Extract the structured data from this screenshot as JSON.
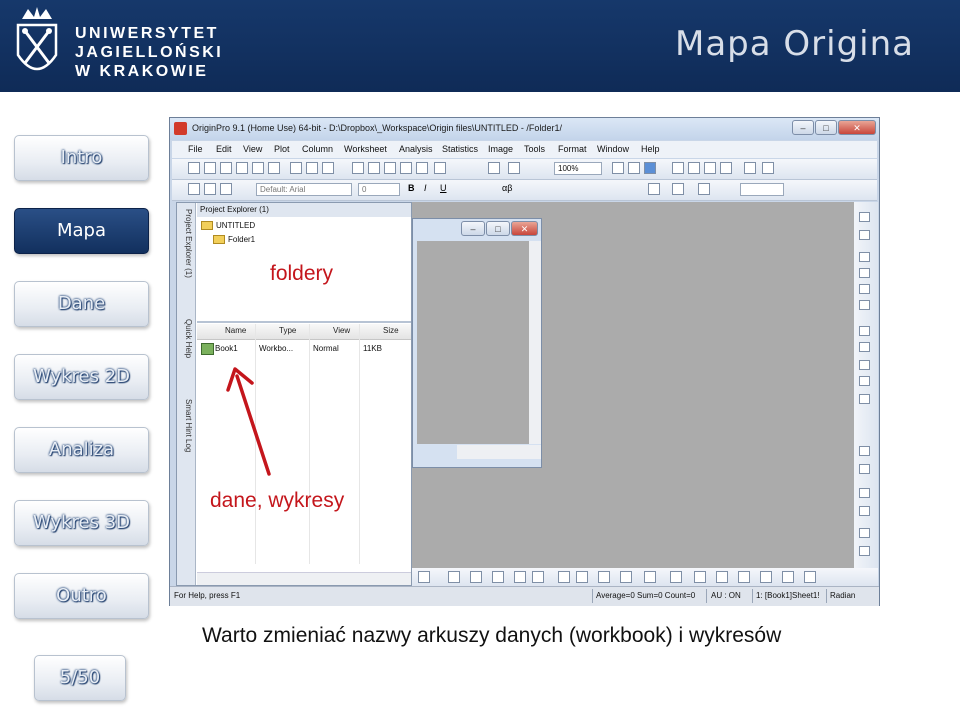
{
  "header": {
    "logo_lines": [
      "UNIWERSYTET",
      "JAGIELLOŃSKI",
      "W KRAKOWIE"
    ],
    "slide_title": "Mapa Origina"
  },
  "nav": {
    "items": [
      {
        "label": "Intro",
        "active": false
      },
      {
        "label": "Mapa",
        "active": true
      },
      {
        "label": "Dane",
        "active": false
      },
      {
        "label": "Wykres 2D",
        "active": false
      },
      {
        "label": "Analiza",
        "active": false
      },
      {
        "label": "Wykres 3D",
        "active": false
      },
      {
        "label": "Outro",
        "active": false
      }
    ],
    "page_counter": "5/50"
  },
  "origin": {
    "title": "OriginPro 9.1 (Home Use) 64-bit - D:\\Dropbox\\_Workspace\\Origin files\\UNTITLED - /Folder1/",
    "menu": [
      "File",
      "Edit",
      "View",
      "Plot",
      "Column",
      "Worksheet",
      "Analysis",
      "Statistics",
      "Image",
      "Tools",
      "Format",
      "Window",
      "Help"
    ],
    "zoom": "100%",
    "font_combo": "Default: Arial",
    "size_combo": "0",
    "explorer_title": "Project Explorer (1)",
    "side_tabs": [
      "Project Explorer (1)",
      "Quick Help",
      "Smart Hint Log"
    ],
    "tree": {
      "root": "UNTITLED",
      "child": "Folder1"
    },
    "columns": [
      "Name",
      "Type",
      "View",
      "Size"
    ],
    "rows": [
      {
        "name": "Book1",
        "type": "Workbo...",
        "view": "Normal",
        "size": "11KB"
      }
    ],
    "status": {
      "help": "For Help, press F1",
      "stats": "Average=0 Sum=0 Count=0",
      "au": "AU : ON",
      "sheet": "1: [Book1]Sheet1!",
      "angle": "Radian"
    }
  },
  "annotations": {
    "folders": "foldery",
    "data": "dane, wykresy"
  },
  "caption": "Warto zmieniać nazwy arkuszy danych (workbook) i wykresów",
  "colors": {
    "header_bg": "#16386b",
    "annotation": "#c4161c",
    "workspace": "#ababab"
  }
}
